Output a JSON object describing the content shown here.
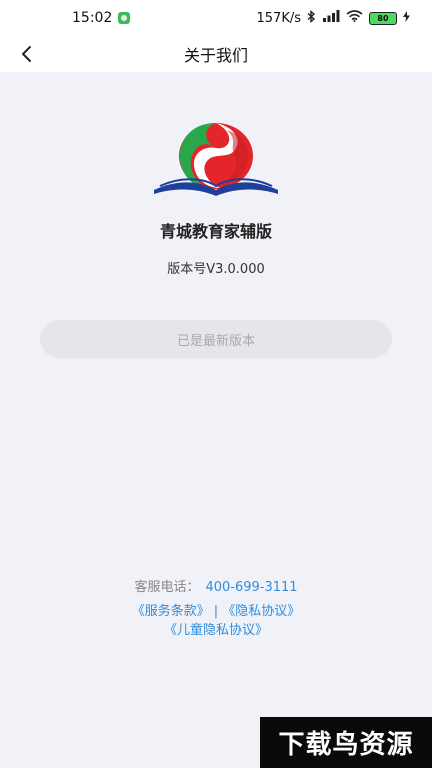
{
  "status_bar": {
    "time": "15:02",
    "network_speed": "157K/s",
    "battery": "80"
  },
  "header": {
    "title": "关于我们",
    "back_icon": "chevron-left-icon"
  },
  "app": {
    "name": "青城教育家辅版",
    "version": "版本号V3.0.000",
    "update_status": "已是最新版本"
  },
  "footer": {
    "service_label": "客服电话：",
    "service_phone": "400-699-3111",
    "terms_link": "《服务条款》",
    "separator": "|",
    "privacy_link": "《隐私协议》",
    "child_privacy_link": "《儿童隐私协议》"
  },
  "watermark": {
    "text": "下载鸟资源"
  },
  "colors": {
    "accent": "#2f8dde",
    "logo_red": "#e4262b",
    "logo_green": "#2aa64b",
    "logo_blue": "#1e3f9a"
  }
}
